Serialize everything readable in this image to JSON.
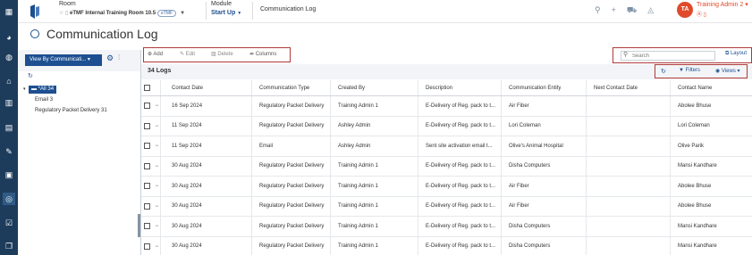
{
  "topbar": {
    "room_label": "Room",
    "room_value": "eTMF Internal Training Room 10.5",
    "room_env": "eTMF",
    "module_label": "Module",
    "module_value": "Start Up",
    "breadcrumb": "Communication Log",
    "user_initials": "TA",
    "user_name": "Training Admin 2",
    "user_sub": "Ⓐ ▯"
  },
  "page": {
    "title": "Communication Log"
  },
  "left_panel": {
    "view_button": "View By Communicati...",
    "tree": {
      "all_label": "*All",
      "all_count": "34",
      "email_label": "Email",
      "email_count": "3",
      "reg_label": "Regulatory Packet Delivery",
      "reg_count": "31"
    }
  },
  "toolbar": {
    "add": "Add",
    "edit": "Edit",
    "delete": "Delete",
    "columns": "Columns",
    "search_placeholder": "Search",
    "layout": "Layout",
    "logs_count": "34 Logs",
    "filters": "Filters",
    "views": "Views"
  },
  "table": {
    "columns": [
      "Contact Date",
      "Communication Type",
      "Created By",
      "Description",
      "Communication Entity",
      "Next Contact Date",
      "Contact Name"
    ],
    "rows": [
      [
        "16 Sep 2024",
        "Regulatory Packet Delivery",
        "Training Admin 1",
        "E-Delivery of Reg. pack to t...",
        "Air Fiber",
        "",
        "Abolee Bhuse"
      ],
      [
        "11 Sep 2024",
        "Regulatory Packet Delivery",
        "Ashley Admin",
        "E-Delivery of Reg. pack to t...",
        "Lori Coleman",
        "",
        "Lori Coleman"
      ],
      [
        "11 Sep 2024",
        "Email",
        "Ashley Admin",
        "Sent site activation email t...",
        "Olive's Animal Hospital",
        "",
        "Olive Parik"
      ],
      [
        "30 Aug 2024",
        "Regulatory Packet Delivery",
        "Training Admin 1",
        "E-Delivery of Reg. pack to t...",
        "Disha Computers",
        "",
        "Mansi Kandhare"
      ],
      [
        "30 Aug 2024",
        "Regulatory Packet Delivery",
        "Training Admin 1",
        "E-Delivery of Reg. pack to t...",
        "Air Fiber",
        "",
        "Abolee Bhuse"
      ],
      [
        "30 Aug 2024",
        "Regulatory Packet Delivery",
        "Training Admin 1",
        "E-Delivery of Reg. pack to t...",
        "Air Fiber",
        "",
        "Abolee Bhuse"
      ],
      [
        "30 Aug 2024",
        "Regulatory Packet Delivery",
        "Training Admin 1",
        "E-Delivery of Reg. pack to t...",
        "Disha Computers",
        "",
        "Mansi Kandhare"
      ],
      [
        "30 Aug 2024",
        "Regulatory Packet Delivery",
        "Training Admin 1",
        "E-Delivery of Reg. pack to t...",
        "Disha Computers",
        "",
        "Mansi Kandhare"
      ]
    ]
  },
  "colors": {
    "accent": "#1d4f91",
    "rail": "#1d3c5c",
    "highlight_box": "#b03a3a",
    "avatar": "#e04a2b"
  }
}
